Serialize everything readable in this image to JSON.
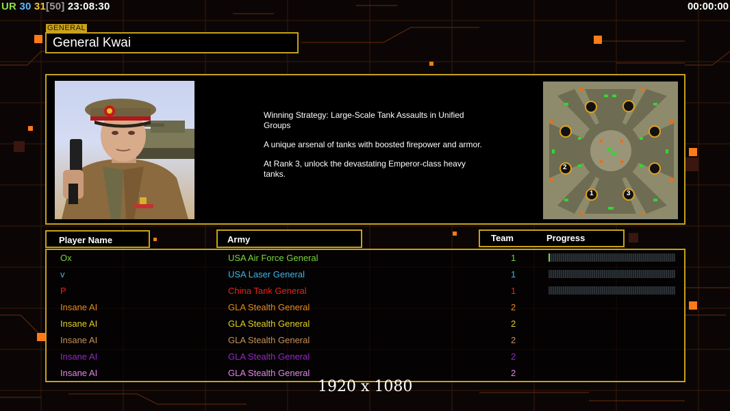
{
  "hud": {
    "ur_label": "UR",
    "val_a": "30",
    "val_b": "31",
    "val_c": "[50]",
    "time": "23:08:30",
    "game_timer": "00:00:00"
  },
  "general": {
    "label": "GENERAL",
    "name": "General Kwai",
    "strategy": [
      "Winning Strategy: Large-Scale Tank Assaults in Unified Groups",
      "A unique arsenal of tanks with boosted firepower and armor.",
      "At Rank 3, unlock the devastating Emperor-class heavy tanks."
    ]
  },
  "map": {
    "markers": [
      "2",
      "1",
      "3"
    ]
  },
  "table": {
    "col_player": "Player Name",
    "col_army": "Army",
    "col_team": "Team",
    "col_progress": "Progress",
    "rows": [
      {
        "name": "Ox",
        "army": "USA Air Force General",
        "team": "1",
        "color": "#78d83c",
        "progress": 0.01
      },
      {
        "name": "v",
        "army": "USA Laser General",
        "team": "1",
        "color": "#3fb6e8",
        "progress": 0
      },
      {
        "name": "P",
        "army": "China Tank General",
        "team": "1",
        "color": "#e8241c",
        "progress": 0
      },
      {
        "name": "Insane AI",
        "army": "GLA Stealth General",
        "team": "2",
        "color": "#e88c1c",
        "progress": null
      },
      {
        "name": "Insane AI",
        "army": "GLA Stealth General",
        "team": "2",
        "color": "#e0d02a",
        "progress": null
      },
      {
        "name": "Insane AI",
        "army": "GLA Stealth General",
        "team": "2",
        "color": "#c8915a",
        "progress": null
      },
      {
        "name": "Insane AI",
        "army": "GLA Stealth General",
        "team": "2",
        "color": "#9628c8",
        "progress": null
      },
      {
        "name": "Insane AI",
        "army": "GLA Stealth General",
        "team": "2",
        "color": "#e088e8",
        "progress": null
      }
    ]
  },
  "overlay": {
    "resolution": "1920 x 1080"
  },
  "colors": {
    "accent_gold": "#c8a21a",
    "circuit_orange": "#ff7a18"
  }
}
